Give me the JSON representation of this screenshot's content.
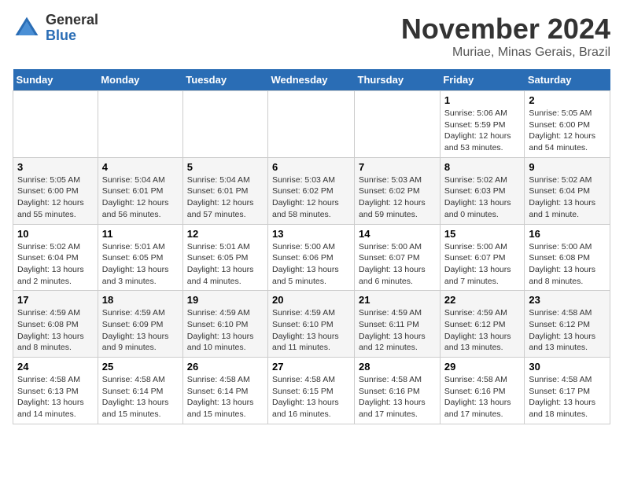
{
  "logo": {
    "general": "General",
    "blue": "Blue"
  },
  "title": "November 2024",
  "location": "Muriae, Minas Gerais, Brazil",
  "days_of_week": [
    "Sunday",
    "Monday",
    "Tuesday",
    "Wednesday",
    "Thursday",
    "Friday",
    "Saturday"
  ],
  "weeks": [
    [
      {
        "day": "",
        "info": ""
      },
      {
        "day": "",
        "info": ""
      },
      {
        "day": "",
        "info": ""
      },
      {
        "day": "",
        "info": ""
      },
      {
        "day": "",
        "info": ""
      },
      {
        "day": "1",
        "info": "Sunrise: 5:06 AM\nSunset: 5:59 PM\nDaylight: 12 hours\nand 53 minutes."
      },
      {
        "day": "2",
        "info": "Sunrise: 5:05 AM\nSunset: 6:00 PM\nDaylight: 12 hours\nand 54 minutes."
      }
    ],
    [
      {
        "day": "3",
        "info": "Sunrise: 5:05 AM\nSunset: 6:00 PM\nDaylight: 12 hours\nand 55 minutes."
      },
      {
        "day": "4",
        "info": "Sunrise: 5:04 AM\nSunset: 6:01 PM\nDaylight: 12 hours\nand 56 minutes."
      },
      {
        "day": "5",
        "info": "Sunrise: 5:04 AM\nSunset: 6:01 PM\nDaylight: 12 hours\nand 57 minutes."
      },
      {
        "day": "6",
        "info": "Sunrise: 5:03 AM\nSunset: 6:02 PM\nDaylight: 12 hours\nand 58 minutes."
      },
      {
        "day": "7",
        "info": "Sunrise: 5:03 AM\nSunset: 6:02 PM\nDaylight: 12 hours\nand 59 minutes."
      },
      {
        "day": "8",
        "info": "Sunrise: 5:02 AM\nSunset: 6:03 PM\nDaylight: 13 hours\nand 0 minutes."
      },
      {
        "day": "9",
        "info": "Sunrise: 5:02 AM\nSunset: 6:04 PM\nDaylight: 13 hours\nand 1 minute."
      }
    ],
    [
      {
        "day": "10",
        "info": "Sunrise: 5:02 AM\nSunset: 6:04 PM\nDaylight: 13 hours\nand 2 minutes."
      },
      {
        "day": "11",
        "info": "Sunrise: 5:01 AM\nSunset: 6:05 PM\nDaylight: 13 hours\nand 3 minutes."
      },
      {
        "day": "12",
        "info": "Sunrise: 5:01 AM\nSunset: 6:05 PM\nDaylight: 13 hours\nand 4 minutes."
      },
      {
        "day": "13",
        "info": "Sunrise: 5:00 AM\nSunset: 6:06 PM\nDaylight: 13 hours\nand 5 minutes."
      },
      {
        "day": "14",
        "info": "Sunrise: 5:00 AM\nSunset: 6:07 PM\nDaylight: 13 hours\nand 6 minutes."
      },
      {
        "day": "15",
        "info": "Sunrise: 5:00 AM\nSunset: 6:07 PM\nDaylight: 13 hours\nand 7 minutes."
      },
      {
        "day": "16",
        "info": "Sunrise: 5:00 AM\nSunset: 6:08 PM\nDaylight: 13 hours\nand 8 minutes."
      }
    ],
    [
      {
        "day": "17",
        "info": "Sunrise: 4:59 AM\nSunset: 6:08 PM\nDaylight: 13 hours\nand 8 minutes."
      },
      {
        "day": "18",
        "info": "Sunrise: 4:59 AM\nSunset: 6:09 PM\nDaylight: 13 hours\nand 9 minutes."
      },
      {
        "day": "19",
        "info": "Sunrise: 4:59 AM\nSunset: 6:10 PM\nDaylight: 13 hours\nand 10 minutes."
      },
      {
        "day": "20",
        "info": "Sunrise: 4:59 AM\nSunset: 6:10 PM\nDaylight: 13 hours\nand 11 minutes."
      },
      {
        "day": "21",
        "info": "Sunrise: 4:59 AM\nSunset: 6:11 PM\nDaylight: 13 hours\nand 12 minutes."
      },
      {
        "day": "22",
        "info": "Sunrise: 4:59 AM\nSunset: 6:12 PM\nDaylight: 13 hours\nand 13 minutes."
      },
      {
        "day": "23",
        "info": "Sunrise: 4:58 AM\nSunset: 6:12 PM\nDaylight: 13 hours\nand 13 minutes."
      }
    ],
    [
      {
        "day": "24",
        "info": "Sunrise: 4:58 AM\nSunset: 6:13 PM\nDaylight: 13 hours\nand 14 minutes."
      },
      {
        "day": "25",
        "info": "Sunrise: 4:58 AM\nSunset: 6:14 PM\nDaylight: 13 hours\nand 15 minutes."
      },
      {
        "day": "26",
        "info": "Sunrise: 4:58 AM\nSunset: 6:14 PM\nDaylight: 13 hours\nand 15 minutes."
      },
      {
        "day": "27",
        "info": "Sunrise: 4:58 AM\nSunset: 6:15 PM\nDaylight: 13 hours\nand 16 minutes."
      },
      {
        "day": "28",
        "info": "Sunrise: 4:58 AM\nSunset: 6:16 PM\nDaylight: 13 hours\nand 17 minutes."
      },
      {
        "day": "29",
        "info": "Sunrise: 4:58 AM\nSunset: 6:16 PM\nDaylight: 13 hours\nand 17 minutes."
      },
      {
        "day": "30",
        "info": "Sunrise: 4:58 AM\nSunset: 6:17 PM\nDaylight: 13 hours\nand 18 minutes."
      }
    ]
  ]
}
